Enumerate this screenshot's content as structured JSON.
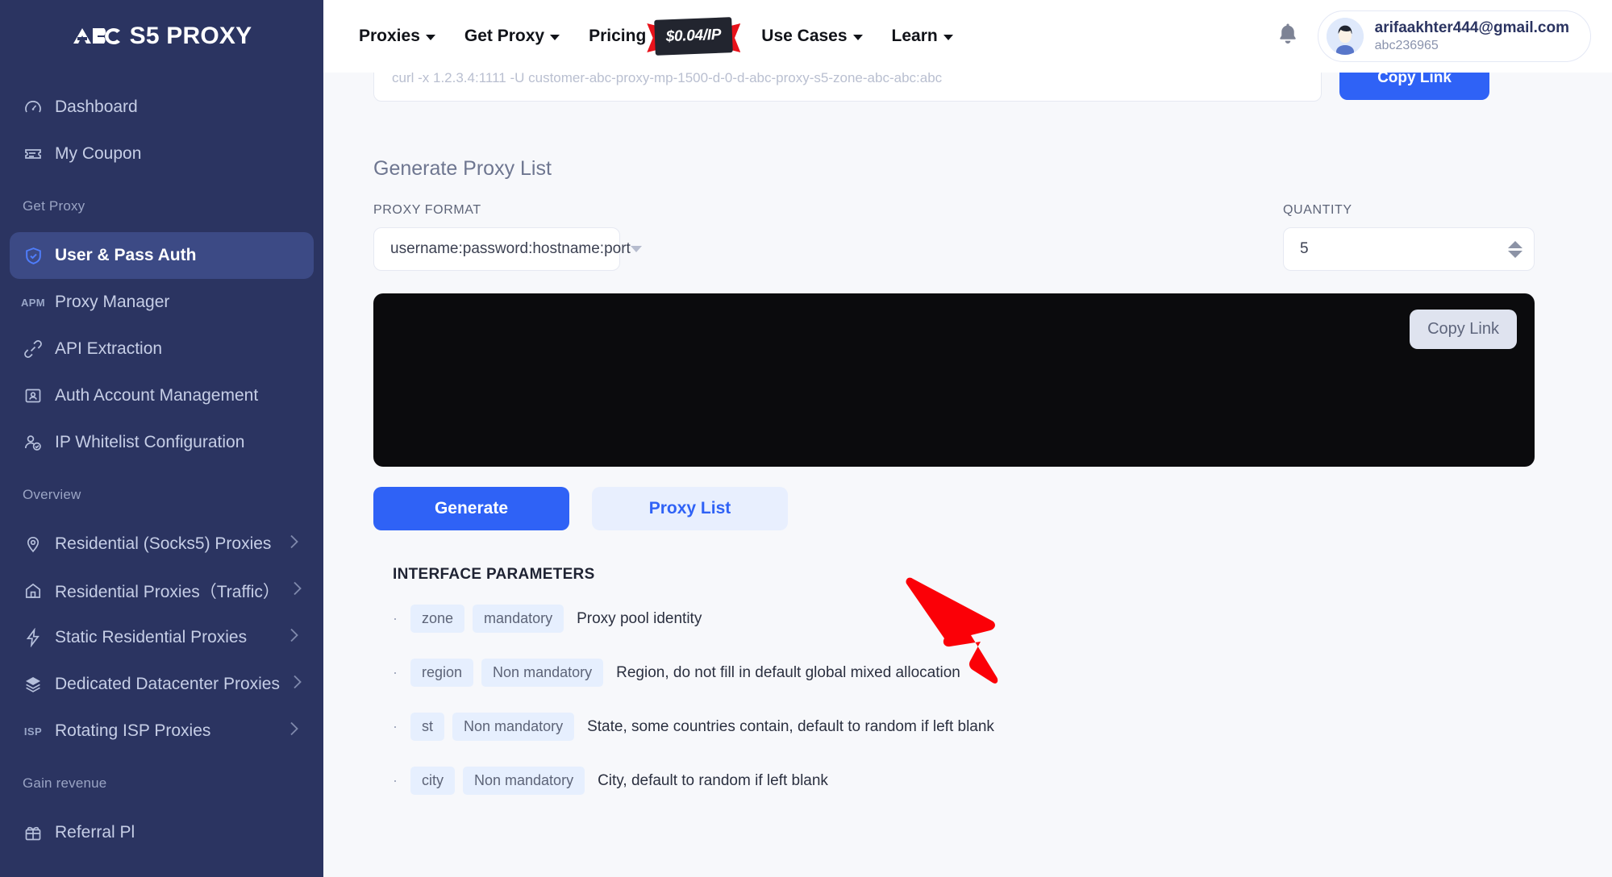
{
  "brand": {
    "logo_text": "ABC",
    "name": "S5 PROXY"
  },
  "sidebar": {
    "primary": [
      {
        "label": "Dashboard",
        "icon": "gauge-icon"
      },
      {
        "label": "My Coupon",
        "icon": "ticket-icon"
      }
    ],
    "group_get_proxy": "Get Proxy",
    "get_proxy_items": [
      {
        "label": "User & Pass Auth",
        "icon": "shield-check-icon",
        "active": true
      },
      {
        "label": "Proxy Manager",
        "icon": "apm-badge-icon",
        "badge": "APM"
      },
      {
        "label": "API Extraction",
        "icon": "link-icon"
      },
      {
        "label": "Auth Account Management",
        "icon": "id-card-icon"
      },
      {
        "label": "IP Whitelist Configuration",
        "icon": "user-check-icon"
      }
    ],
    "group_overview": "Overview",
    "overview_items": [
      {
        "label": "Residential (Socks5) Proxies",
        "icon": "map-pin-icon"
      },
      {
        "label": "Residential Proxies（Traffic）",
        "icon": "home-icon"
      },
      {
        "label": "Static Residential Proxies",
        "icon": "bolt-icon"
      },
      {
        "label": "Dedicated Datacenter Proxies",
        "icon": "layers-icon"
      },
      {
        "label": "Rotating ISP Proxies",
        "icon": "isp-badge-icon",
        "badge": "ISP"
      }
    ],
    "group_gain_revenue": "Gain revenue",
    "gain_revenue_items": [
      {
        "label": "Referral Pl",
        "icon": "gift-icon"
      }
    ]
  },
  "topnav": {
    "items": [
      {
        "label": "Proxies",
        "caret": true
      },
      {
        "label": "Get Proxy",
        "caret": true
      },
      {
        "label": "Pricing",
        "caret": false
      },
      {
        "label": "Use Cases",
        "caret": true
      },
      {
        "label": "Learn",
        "caret": true
      }
    ],
    "price_badge": "$0.04/IP",
    "bell": "notification-bell-icon",
    "account": {
      "email": "arifaakhter444@gmail.com",
      "user_id": "abc236965"
    }
  },
  "clipped_row": {
    "input_text": "curl -x 1.2.3.4:1111 -U customer-abc-proxy-mp-1500-d-0-d-abc-proxy-s5-zone-abc-abc:abc",
    "copy_button": "Copy Link"
  },
  "main": {
    "panel_title": "Generate Proxy List",
    "proxy_format": {
      "label": "PROXY FORMAT",
      "value": "username:password:hostname:port"
    },
    "quantity": {
      "label": "QUANTITY",
      "value": "5"
    },
    "output": {
      "text": "",
      "copy_button": "Copy Link"
    },
    "buttons": {
      "generate": "Generate",
      "proxy_list": "Proxy List"
    },
    "params_title": "INTERFACE PARAMETERS",
    "params": [
      {
        "name": "zone",
        "required": "mandatory",
        "desc": "Proxy pool identity"
      },
      {
        "name": "region",
        "required": "Non mandatory",
        "desc": "Region, do not fill in default global mixed allocation"
      },
      {
        "name": "st",
        "required": "Non mandatory",
        "desc": "State, some countries contain, default to random if left blank"
      },
      {
        "name": "city",
        "required": "Non mandatory",
        "desc": "City, default to random if left blank"
      }
    ]
  },
  "colors": {
    "sidebar_bg": "#2b3461",
    "sidebar_active": "#3c4a85",
    "accent_blue": "#2f62f6",
    "page_bg": "#f7f8fb",
    "output_bg": "#0b0b0d",
    "annotation_red": "#fb0007"
  }
}
